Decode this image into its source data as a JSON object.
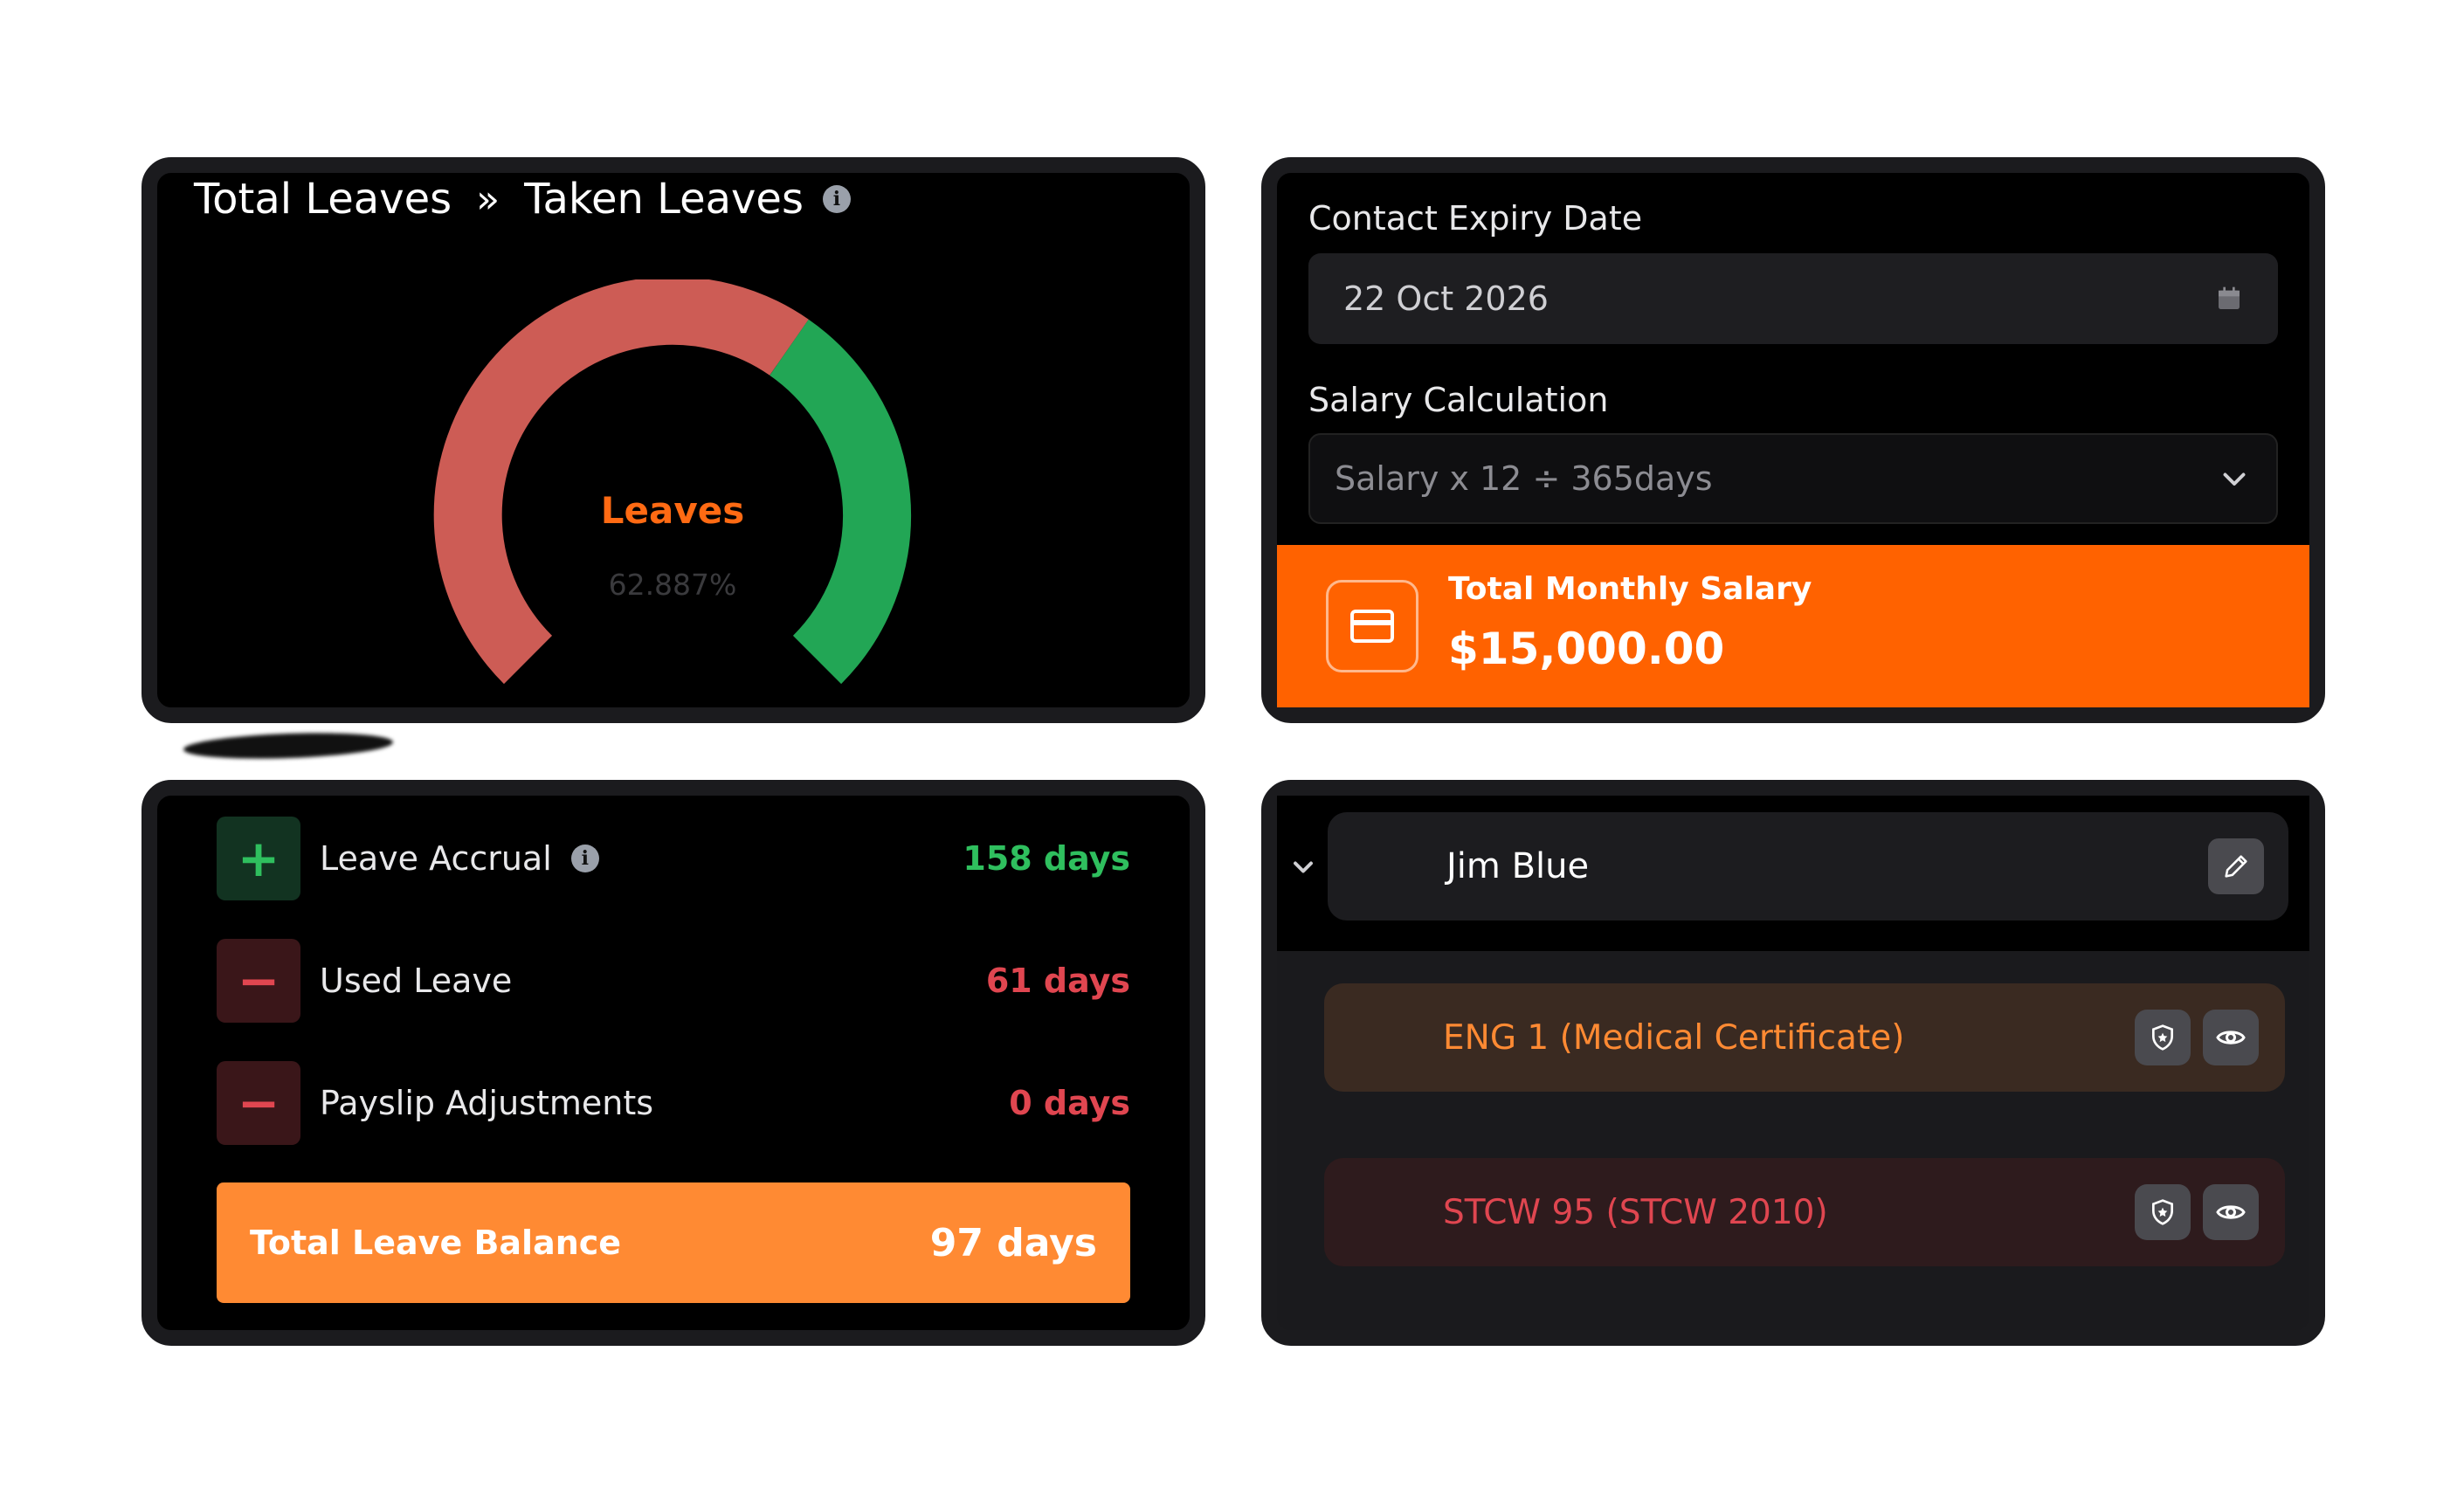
{
  "leaves_card": {
    "breadcrumb": [
      "Total Leaves",
      "»",
      "Taken Leaves"
    ],
    "info_icon": "info-icon",
    "gauge": {
      "title": "Leaves",
      "value_text": "62.887%",
      "taken_fraction": 0.62887,
      "colors": {
        "taken": "#cd5c55",
        "remaining": "#22a655"
      }
    }
  },
  "salary_card": {
    "expiry_label": "Contact Expiry Date",
    "expiry_value": "22 Oct 2026",
    "calendar_icon": "calendar-icon",
    "calc_label": "Salary Calculation",
    "calc_value": "Salary x 12 ÷ 365days",
    "total_title": "Total Monthly Salary",
    "total_amount": "$15,000.00",
    "accent": "#ff6200"
  },
  "leave_summary": {
    "rows": [
      {
        "sign": "+",
        "label": "Leave Accrual",
        "value": "158 days",
        "tone": "green",
        "info": true
      },
      {
        "sign": "−",
        "label": "Used Leave",
        "value": "61 days",
        "tone": "red"
      },
      {
        "sign": "−",
        "label": "Payslip Adjustments",
        "value": "0 days",
        "tone": "red"
      }
    ],
    "balance_label": "Total Leave Balance",
    "balance_value": "97 days",
    "balance_color": "#ff8a33"
  },
  "documents": {
    "person_name": "Jim Blue",
    "items": [
      {
        "label": "ENG 1 (Medical Certificate)",
        "status_color": "#ff8a33"
      },
      {
        "label": "STCW 95 (STCW 2010)",
        "status_color": "#e04650"
      }
    ]
  }
}
